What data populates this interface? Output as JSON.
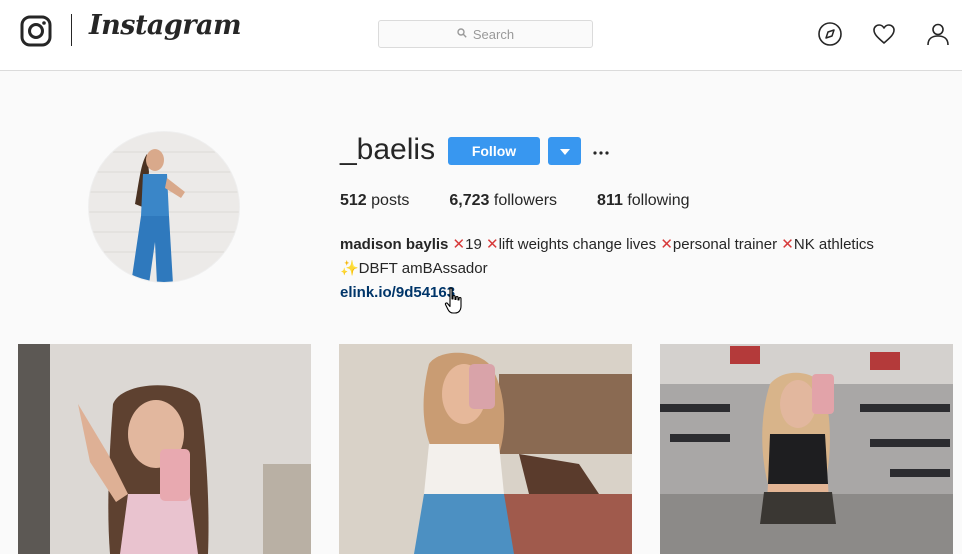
{
  "nav": {
    "brand": "Instagram",
    "search_placeholder": "Search",
    "icons": [
      "instagram-glyph-icon",
      "search-icon",
      "explore-compass-icon",
      "activity-heart-icon",
      "profile-user-icon"
    ]
  },
  "profile": {
    "username": "_baelis",
    "follow_label": "Follow",
    "more_label": "•••",
    "stats": {
      "posts_count": "512",
      "posts_label": "posts",
      "followers_count": "6,723",
      "followers_label": "followers",
      "following_count": "811",
      "following_label": "following"
    },
    "bio": {
      "full_name": "madison baylis",
      "mark": "✕",
      "segment_1": "19 ",
      "segment_2": "lift weights change lives ",
      "segment_3": "personal trainer ",
      "segment_4": "NK athletics",
      "line_2": "✨DBFT amBAssador",
      "link": "elink.io/9d54163"
    }
  },
  "colors": {
    "accent": "#3897f0",
    "link": "#003569",
    "bio_mark": "#d73a3a",
    "background": "#fafafa"
  },
  "posts": [
    {
      "label": "post-1",
      "multi": true
    },
    {
      "label": "post-2",
      "multi": false
    },
    {
      "label": "post-3",
      "multi": false
    }
  ]
}
